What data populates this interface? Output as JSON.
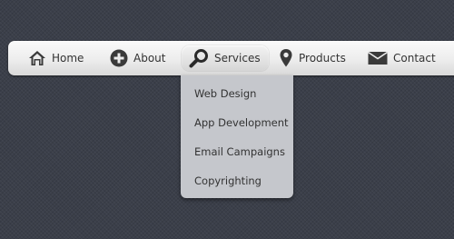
{
  "nav": {
    "items": [
      {
        "label": "Home",
        "icon": "home-icon"
      },
      {
        "label": "About",
        "icon": "plus-circle-icon"
      },
      {
        "label": "Services",
        "icon": "magnifier-icon",
        "active": true
      },
      {
        "label": "Products",
        "icon": "map-pin-icon"
      },
      {
        "label": "Contact",
        "icon": "envelope-icon"
      }
    ]
  },
  "dropdown": {
    "items": [
      {
        "label": "Web Design"
      },
      {
        "label": "App Development"
      },
      {
        "label": "Email Campaigns"
      },
      {
        "label": "Copyrighting"
      }
    ]
  },
  "colors": {
    "background": "#3b3f4a",
    "navbar": "#ededed",
    "dropdown": "#c5c7cc",
    "text": "#333333",
    "icon": "#3a3a3a"
  }
}
